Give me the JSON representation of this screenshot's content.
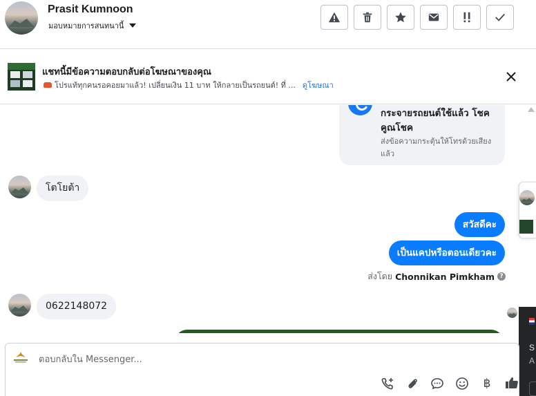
{
  "header": {
    "name": "Prasit Kumnoon",
    "assign_label": "มอบหมายการสนทนานี้",
    "actions": [
      {
        "icon": "warning-icon",
        "label": "Mark as spam"
      },
      {
        "icon": "trash-icon",
        "label": "Delete"
      },
      {
        "icon": "star-icon",
        "label": "Star"
      },
      {
        "icon": "envelope-icon",
        "label": "Mark as unread"
      },
      {
        "icon": "priority-icon",
        "label": "Follow up"
      },
      {
        "icon": "check-icon",
        "label": "Mark as done"
      }
    ]
  },
  "ad_banner": {
    "title": "แชทนี้มีข้อความตอบกลับต่อโฆษณาของคุณ",
    "description": "โปรแท้ทุกคนรอคอยมาแล้ว! เปลี่ยนเงิน 11 บาท ให้กลายเป็นรถยนต์! ที่ ...",
    "link": "ดูโฆษณา",
    "close_icon": "close-icon"
  },
  "messages": {
    "system_card": {
      "title": "กระจายรถยนต์ใช้แล้ว โชคคูณโชค",
      "description": "ส่งข้อความกระตุ้นให้โทรด้วยเสียงแล้ว"
    },
    "incoming_1": "โตโยต้า",
    "outgoing_1": "สวัสดีคะ",
    "outgoing_2": "เป็นแคปหรือตอนเดียวคะ",
    "sent_by_prefix": "ส่งโดย",
    "sent_by_name": "Chonnikan Pimkham",
    "incoming_2": "0622148072"
  },
  "side_popup": {
    "line1": "S",
    "line2": "A"
  },
  "composer": {
    "placeholder": "ตอบกลับใน Messenger...",
    "tools": [
      "add-call-icon",
      "attachment-icon",
      "saved-reply-icon",
      "emoji-icon",
      "baht-icon"
    ],
    "baht_symbol": "฿",
    "like_icon": "thumbs-up-icon"
  },
  "colors": {
    "accent": "#0a7cff",
    "incoming_bubble": "#f0f2f5",
    "link": "#1877f2"
  }
}
